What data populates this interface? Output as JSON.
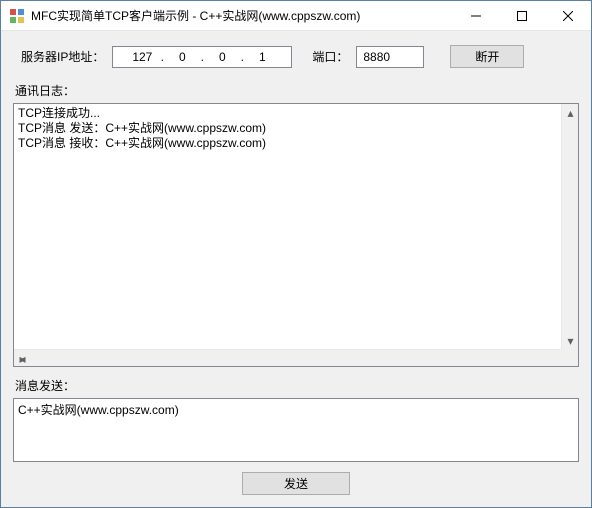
{
  "window": {
    "title": "MFC实现简单TCP客户端示例 - C++实战网(www.cppszw.com)"
  },
  "connection": {
    "ip_label": "服务器IP地址：",
    "ip": {
      "a": "127",
      "b": "0",
      "c": "0",
      "d": "1"
    },
    "port_label": "端口：",
    "port_value": "8880",
    "disconnect_label": "断开"
  },
  "log": {
    "label": "通讯日志：",
    "lines": [
      "TCP连接成功...",
      "TCP消息 发送：C++实战网(www.cppszw.com)",
      "TCP消息 接收：C++实战网(www.cppszw.com)"
    ]
  },
  "send": {
    "label": "消息发送：",
    "value": "C++实战网(www.cppszw.com)",
    "button_label": "发送"
  }
}
